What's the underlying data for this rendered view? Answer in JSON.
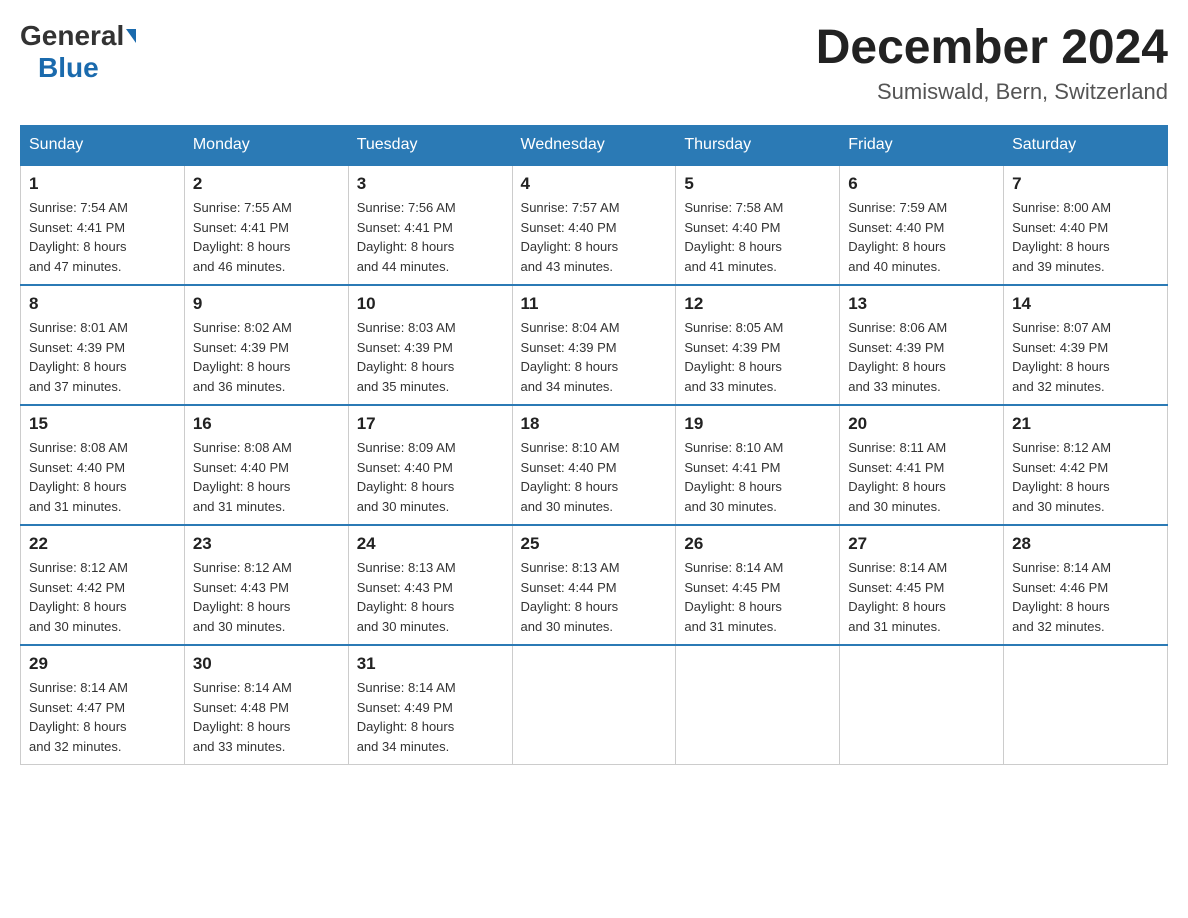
{
  "header": {
    "logo_general": "General",
    "logo_blue": "Blue",
    "month_title": "December 2024",
    "location": "Sumiswald, Bern, Switzerland"
  },
  "days_of_week": [
    "Sunday",
    "Monday",
    "Tuesday",
    "Wednesday",
    "Thursday",
    "Friday",
    "Saturday"
  ],
  "weeks": [
    [
      {
        "day": "1",
        "sunrise": "7:54 AM",
        "sunset": "4:41 PM",
        "daylight": "8 hours and 47 minutes."
      },
      {
        "day": "2",
        "sunrise": "7:55 AM",
        "sunset": "4:41 PM",
        "daylight": "8 hours and 46 minutes."
      },
      {
        "day": "3",
        "sunrise": "7:56 AM",
        "sunset": "4:41 PM",
        "daylight": "8 hours and 44 minutes."
      },
      {
        "day": "4",
        "sunrise": "7:57 AM",
        "sunset": "4:40 PM",
        "daylight": "8 hours and 43 minutes."
      },
      {
        "day": "5",
        "sunrise": "7:58 AM",
        "sunset": "4:40 PM",
        "daylight": "8 hours and 41 minutes."
      },
      {
        "day": "6",
        "sunrise": "7:59 AM",
        "sunset": "4:40 PM",
        "daylight": "8 hours and 40 minutes."
      },
      {
        "day": "7",
        "sunrise": "8:00 AM",
        "sunset": "4:40 PM",
        "daylight": "8 hours and 39 minutes."
      }
    ],
    [
      {
        "day": "8",
        "sunrise": "8:01 AM",
        "sunset": "4:39 PM",
        "daylight": "8 hours and 37 minutes."
      },
      {
        "day": "9",
        "sunrise": "8:02 AM",
        "sunset": "4:39 PM",
        "daylight": "8 hours and 36 minutes."
      },
      {
        "day": "10",
        "sunrise": "8:03 AM",
        "sunset": "4:39 PM",
        "daylight": "8 hours and 35 minutes."
      },
      {
        "day": "11",
        "sunrise": "8:04 AM",
        "sunset": "4:39 PM",
        "daylight": "8 hours and 34 minutes."
      },
      {
        "day": "12",
        "sunrise": "8:05 AM",
        "sunset": "4:39 PM",
        "daylight": "8 hours and 33 minutes."
      },
      {
        "day": "13",
        "sunrise": "8:06 AM",
        "sunset": "4:39 PM",
        "daylight": "8 hours and 33 minutes."
      },
      {
        "day": "14",
        "sunrise": "8:07 AM",
        "sunset": "4:39 PM",
        "daylight": "8 hours and 32 minutes."
      }
    ],
    [
      {
        "day": "15",
        "sunrise": "8:08 AM",
        "sunset": "4:40 PM",
        "daylight": "8 hours and 31 minutes."
      },
      {
        "day": "16",
        "sunrise": "8:08 AM",
        "sunset": "4:40 PM",
        "daylight": "8 hours and 31 minutes."
      },
      {
        "day": "17",
        "sunrise": "8:09 AM",
        "sunset": "4:40 PM",
        "daylight": "8 hours and 30 minutes."
      },
      {
        "day": "18",
        "sunrise": "8:10 AM",
        "sunset": "4:40 PM",
        "daylight": "8 hours and 30 minutes."
      },
      {
        "day": "19",
        "sunrise": "8:10 AM",
        "sunset": "4:41 PM",
        "daylight": "8 hours and 30 minutes."
      },
      {
        "day": "20",
        "sunrise": "8:11 AM",
        "sunset": "4:41 PM",
        "daylight": "8 hours and 30 minutes."
      },
      {
        "day": "21",
        "sunrise": "8:12 AM",
        "sunset": "4:42 PM",
        "daylight": "8 hours and 30 minutes."
      }
    ],
    [
      {
        "day": "22",
        "sunrise": "8:12 AM",
        "sunset": "4:42 PM",
        "daylight": "8 hours and 30 minutes."
      },
      {
        "day": "23",
        "sunrise": "8:12 AM",
        "sunset": "4:43 PM",
        "daylight": "8 hours and 30 minutes."
      },
      {
        "day": "24",
        "sunrise": "8:13 AM",
        "sunset": "4:43 PM",
        "daylight": "8 hours and 30 minutes."
      },
      {
        "day": "25",
        "sunrise": "8:13 AM",
        "sunset": "4:44 PM",
        "daylight": "8 hours and 30 minutes."
      },
      {
        "day": "26",
        "sunrise": "8:14 AM",
        "sunset": "4:45 PM",
        "daylight": "8 hours and 31 minutes."
      },
      {
        "day": "27",
        "sunrise": "8:14 AM",
        "sunset": "4:45 PM",
        "daylight": "8 hours and 31 minutes."
      },
      {
        "day": "28",
        "sunrise": "8:14 AM",
        "sunset": "4:46 PM",
        "daylight": "8 hours and 32 minutes."
      }
    ],
    [
      {
        "day": "29",
        "sunrise": "8:14 AM",
        "sunset": "4:47 PM",
        "daylight": "8 hours and 32 minutes."
      },
      {
        "day": "30",
        "sunrise": "8:14 AM",
        "sunset": "4:48 PM",
        "daylight": "8 hours and 33 minutes."
      },
      {
        "day": "31",
        "sunrise": "8:14 AM",
        "sunset": "4:49 PM",
        "daylight": "8 hours and 34 minutes."
      },
      null,
      null,
      null,
      null
    ]
  ]
}
